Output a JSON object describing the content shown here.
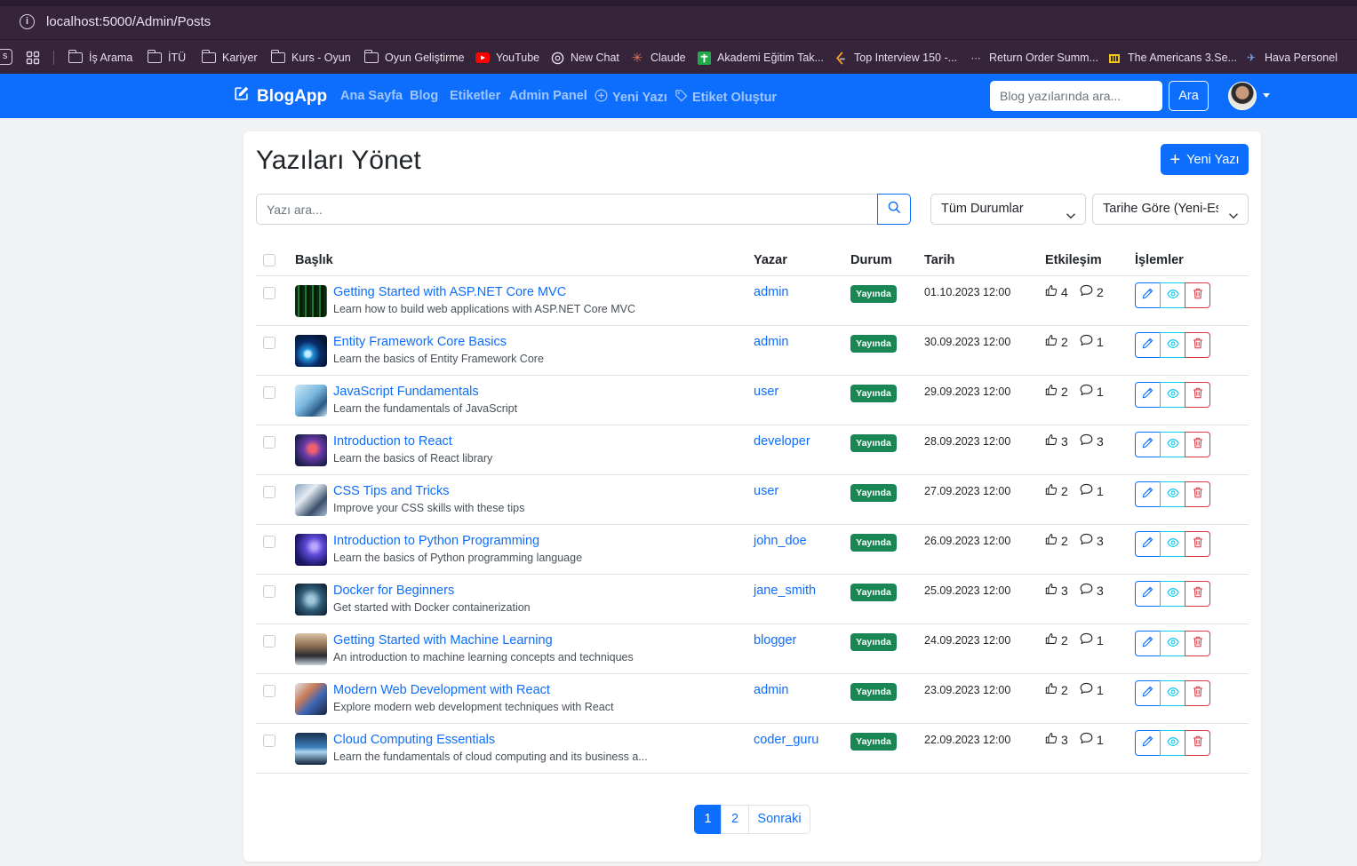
{
  "browser": {
    "url": "localhost:5000/Admin/Posts",
    "bookmarks": [
      {
        "label": "İş Arama",
        "icon": "folder-icon"
      },
      {
        "label": "İTÜ",
        "icon": "folder-icon"
      },
      {
        "label": "Kariyer",
        "icon": "folder-icon"
      },
      {
        "label": "Kurs - Oyun",
        "icon": "folder-icon"
      },
      {
        "label": "Oyun Geliştirme",
        "icon": "folder-icon"
      },
      {
        "label": "YouTube",
        "icon": "youtube-icon"
      },
      {
        "label": "New Chat",
        "icon": "chatgpt-icon"
      },
      {
        "label": "Claude",
        "icon": "claude-icon"
      },
      {
        "label": "Akademi Eğitim Tak...",
        "icon": "akademi-icon"
      },
      {
        "label": "Top Interview 150 -...",
        "icon": "leetcode-icon"
      },
      {
        "label": "Return Order Summ...",
        "icon": "return-icon"
      },
      {
        "label": "The Americans 3.Se...",
        "icon": "tv-icon"
      },
      {
        "label": "Hava Personel",
        "icon": "plane-icon"
      }
    ]
  },
  "navbar": {
    "brand": "BlogApp",
    "links": [
      "Ana Sayfa",
      "Blog",
      "Etiketler",
      "Admin Panel",
      "Yeni Yazı",
      "Etiket Oluştur"
    ],
    "search_placeholder": "Blog yazılarında ara...",
    "search_button": "Ara"
  },
  "page": {
    "title": "Yazıları Yönet",
    "new_button": "Yeni Yazı",
    "search_placeholder": "Yazı ara...",
    "status_filter": "Tüm Durumlar",
    "sort_filter": "Tarihe Göre (Yeni-Eski)"
  },
  "table": {
    "headers": [
      "Başlık",
      "Yazar",
      "Durum",
      "Tarih",
      "Etkileşim",
      "İşlemler"
    ],
    "rows": [
      {
        "title": "Getting Started with ASP.NET Core MVC",
        "desc": "Learn how to build web applications with ASP.NET Core MVC",
        "author": "admin",
        "status": "Yayında",
        "date": "01.10.2023 12:00",
        "likes": "4",
        "comments": "2",
        "thumb": "matrix"
      },
      {
        "title": "Entity Framework Core Basics",
        "desc": "Learn the basics of Entity Framework Core",
        "author": "admin",
        "status": "Yayında",
        "date": "30.09.2023 12:00",
        "likes": "2",
        "comments": "1",
        "thumb": "blue-glow"
      },
      {
        "title": "JavaScript Fundamentals",
        "desc": "Learn the fundamentals of JavaScript",
        "author": "user",
        "status": "Yayında",
        "date": "29.09.2023 12:00",
        "likes": "2",
        "comments": "1",
        "thumb": "light-blue"
      },
      {
        "title": "Introduction to React",
        "desc": "Learn the basics of React library",
        "author": "developer",
        "status": "Yayında",
        "date": "28.09.2023 12:00",
        "likes": "3",
        "comments": "3",
        "thumb": "purple-red"
      },
      {
        "title": "CSS Tips and Tricks",
        "desc": "Improve your CSS skills with these tips",
        "author": "user",
        "status": "Yayında",
        "date": "27.09.2023 12:00",
        "likes": "2",
        "comments": "1",
        "thumb": "grey-blue"
      },
      {
        "title": "Introduction to Python Programming",
        "desc": "Learn the basics of Python programming language",
        "author": "john_doe",
        "status": "Yayında",
        "date": "26.09.2023 12:00",
        "likes": "2",
        "comments": "3",
        "thumb": "violet"
      },
      {
        "title": "Docker for Beginners",
        "desc": "Get started with Docker containerization",
        "author": "jane_smith",
        "status": "Yayında",
        "date": "25.09.2023 12:00",
        "likes": "3",
        "comments": "3",
        "thumb": "dark-teal"
      },
      {
        "title": "Getting Started with Machine Learning",
        "desc": "An introduction to machine learning concepts and techniques",
        "author": "blogger",
        "status": "Yayında",
        "date": "24.09.2023 12:00",
        "likes": "2",
        "comments": "1",
        "thumb": "office"
      },
      {
        "title": "Modern Web Development with React",
        "desc": "Explore modern web development techniques with React",
        "author": "admin",
        "status": "Yayında",
        "date": "23.09.2023 12:00",
        "likes": "2",
        "comments": "1",
        "thumb": "hands"
      },
      {
        "title": "Cloud Computing Essentials",
        "desc": "Learn the fundamentals of cloud computing and its business a...",
        "author": "coder_guru",
        "status": "Yayında",
        "date": "22.09.2023 12:00",
        "likes": "3",
        "comments": "1",
        "thumb": "city"
      }
    ]
  },
  "pagination": {
    "pages": [
      "1",
      "2"
    ],
    "next": "Sonraki",
    "active": "1"
  },
  "colors": {
    "primary": "#0d6efd",
    "success": "#198754",
    "danger": "#dc3545",
    "info": "#0dcaf0",
    "browser_bg": "#35243a"
  }
}
